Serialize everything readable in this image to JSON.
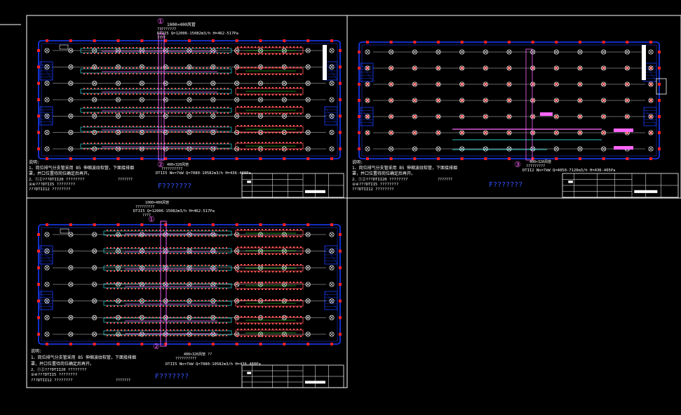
{
  "colors": {
    "background": "#000000",
    "frame": "#ffffff",
    "wall": "#1a3cff",
    "column": "#ff2020",
    "duct_main": "#ff5555",
    "duct_branch": "#ff66ff",
    "duct_cyan": "#33ffff",
    "duct_green": "#33ff33",
    "dim_text": "#ffffff",
    "blue_text": "#3355ff",
    "yellow": "#ffff44"
  },
  "panels": [
    {
      "id": "panel-top-left",
      "marker": "①",
      "marker2": "②",
      "header_line1": "1000×400风管",
      "header_line2": "?????????",
      "header_line3": "DTII5  Q=12006-15082m3/h  H=462-517Pa",
      "header_line4": "????",
      "lower_label1": "400×320风管",
      "lower_label2": "??????????",
      "notes_title": "说明:",
      "note1": "1、岗位排气分支管采用 B5 伸缩波纹软管，下面接排烟",
      "note2": "罩，并口位置待岗位确定后再开。",
      "note3": "2、①②???DTII20  ????????",
      "note4": "②④???DTII5  ????????",
      "note5": "???DTII12  ????????",
      "note_side": "???????",
      "blue_label": "F???????"
    },
    {
      "id": "panel-top-right",
      "marker": "③",
      "header_line1": "400×320风管",
      "header_line2": "?????????",
      "header_line3": "DTII2  Nn=7kW  Q=4050-7120m3/h  H=436-405Pa",
      "notes_title": "说明:",
      "note1": "1、岗位排气分支管采用 B5 伸缩波纹软管，下面接排烟",
      "note2": "罩，并口位置待岗位确定后再开。",
      "note3": "2、①②???DTII20  ????????",
      "note4": "②④???DTII5  ????????",
      "note5": "???DTII12  ????????",
      "note_side": "???????",
      "blue_label": "F???????"
    },
    {
      "id": "panel-bottom-left",
      "marker": "①",
      "marker2": "②",
      "header_line1": "1000×400风管",
      "header_line2": "?????????",
      "header_line3": "DTII5  Q=12006-15082m3/h  H=462-517Pa",
      "header_line4": "????",
      "lower_label1": "400×320风管 ??",
      "lower_label2": "??????????",
      "lower_label3": "DTII5  Nn=7kW  Q=7080-10582m3/h  H=436-480Pa",
      "notes_title": "说明:",
      "note1": "1、岗位排气分支管采用 B5 伸缩波纹软管，下面接排烟",
      "note2": "罩，并口位置待岗位确定后再开。",
      "note3": "2、①②???DTII20  ????????",
      "note4": "②④???DTII5  ????????",
      "note5": "???DTII12  ????????",
      "note_side": "???????",
      "blue_label": "F???????"
    }
  ],
  "top_left_bottom_label": "DTII5  Nn=7kW  Q=7080-10582m3/h  H=436-480Pa"
}
